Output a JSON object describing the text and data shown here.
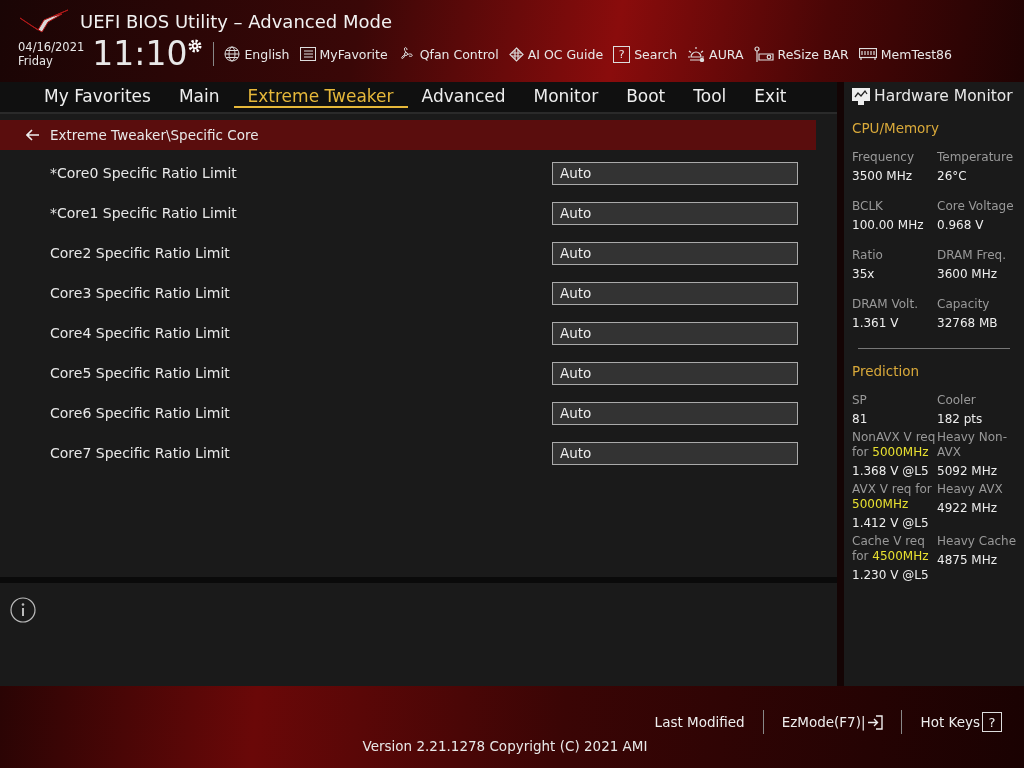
{
  "header": {
    "title": "UEFI BIOS Utility – Advanced Mode",
    "date": "04/16/2021",
    "weekday": "Friday",
    "time": "11:10",
    "tools": [
      {
        "kind": "globe",
        "label": "English"
      },
      {
        "kind": "favorite",
        "label": "MyFavorite"
      },
      {
        "kind": "fan",
        "label": "Qfan Control"
      },
      {
        "kind": "chip",
        "label": "AI OC Guide"
      },
      {
        "kind": "search",
        "label": "Search",
        "icon": "?"
      },
      {
        "kind": "aura",
        "label": "AURA"
      },
      {
        "kind": "card",
        "label": "ReSize BAR"
      },
      {
        "kind": "memory",
        "label": "MemTest86"
      }
    ]
  },
  "menu": [
    {
      "label": "My Favorites",
      "selected": false
    },
    {
      "label": "Main",
      "selected": false
    },
    {
      "label": "Extreme Tweaker",
      "selected": true
    },
    {
      "label": "Advanced",
      "selected": false
    },
    {
      "label": "Monitor",
      "selected": false
    },
    {
      "label": "Boot",
      "selected": false
    },
    {
      "label": "Tool",
      "selected": false
    },
    {
      "label": "Exit",
      "selected": false
    }
  ],
  "breadcrumb": "Extreme Tweaker\\Specific Core",
  "settings": [
    {
      "label": "*Core0 Specific Ratio Limit",
      "value": "Auto"
    },
    {
      "label": "*Core1 Specific Ratio Limit",
      "value": "Auto"
    },
    {
      "label": "Core2 Specific Ratio Limit",
      "value": "Auto"
    },
    {
      "label": "Core3 Specific Ratio Limit",
      "value": "Auto"
    },
    {
      "label": "Core4 Specific Ratio Limit",
      "value": "Auto"
    },
    {
      "label": "Core5 Specific Ratio Limit",
      "value": "Auto"
    },
    {
      "label": "Core6 Specific Ratio Limit",
      "value": "Auto"
    },
    {
      "label": "Core7 Specific Ratio Limit",
      "value": "Auto"
    }
  ],
  "hardware_monitor": {
    "title": "Hardware Monitor",
    "sections": [
      {
        "title": "CPU/Memory",
        "items": [
          {
            "label": "Frequency",
            "value": "3500 MHz"
          },
          {
            "label": "Temperature",
            "value": "26°C"
          },
          {
            "label": "BCLK",
            "value": "100.00 MHz"
          },
          {
            "label": "Core Voltage",
            "value": "0.968 V"
          },
          {
            "label": "Ratio",
            "value": "35x"
          },
          {
            "label": "DRAM Freq.",
            "value": "3600 MHz"
          },
          {
            "label": "DRAM Volt.",
            "value": "1.361 V"
          },
          {
            "label": "Capacity",
            "value": "32768 MB"
          }
        ]
      },
      {
        "title": "Prediction",
        "items": [
          {
            "label": "SP",
            "value": "81"
          },
          {
            "label": "Cooler",
            "value": "182 pts"
          },
          {
            "label": "NonAVX V req for **5000MHz**",
            "value": "1.368 V @L5"
          },
          {
            "label": "Heavy Non-AVX",
            "value": "5092 MHz"
          },
          {
            "label": "AVX V req for **5000MHz**",
            "value": "1.412 V @L5"
          },
          {
            "label": "Heavy AVX",
            "value": "4922 MHz"
          },
          {
            "label": "Cache V req for **4500MHz**",
            "value": "1.230 V @L5"
          },
          {
            "label": "Heavy Cache",
            "value": "4875 MHz"
          }
        ]
      }
    ]
  },
  "footer": {
    "version": "Version 2.21.1278 Copyright (C) 2021 AMI",
    "actions": [
      {
        "kind": "plain",
        "label": "Last Modified"
      },
      {
        "kind": "exit",
        "label": "EzMode(F7)|"
      },
      {
        "kind": "help",
        "label": "Hot Keys",
        "icon": "?"
      }
    ]
  }
}
